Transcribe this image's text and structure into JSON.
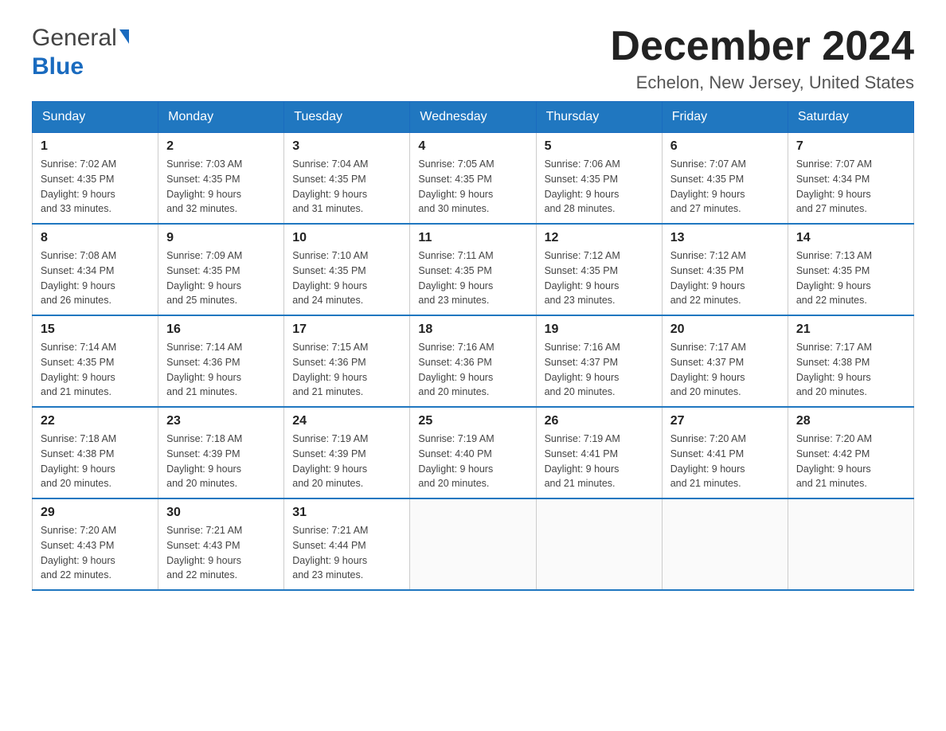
{
  "header": {
    "logo_general": "General",
    "logo_blue": "Blue",
    "title": "December 2024",
    "subtitle": "Echelon, New Jersey, United States"
  },
  "calendar": {
    "days_of_week": [
      "Sunday",
      "Monday",
      "Tuesday",
      "Wednesday",
      "Thursday",
      "Friday",
      "Saturday"
    ],
    "weeks": [
      [
        {
          "day": "1",
          "sunrise": "7:02 AM",
          "sunset": "4:35 PM",
          "daylight": "9 hours and 33 minutes."
        },
        {
          "day": "2",
          "sunrise": "7:03 AM",
          "sunset": "4:35 PM",
          "daylight": "9 hours and 32 minutes."
        },
        {
          "day": "3",
          "sunrise": "7:04 AM",
          "sunset": "4:35 PM",
          "daylight": "9 hours and 31 minutes."
        },
        {
          "day": "4",
          "sunrise": "7:05 AM",
          "sunset": "4:35 PM",
          "daylight": "9 hours and 30 minutes."
        },
        {
          "day": "5",
          "sunrise": "7:06 AM",
          "sunset": "4:35 PM",
          "daylight": "9 hours and 28 minutes."
        },
        {
          "day": "6",
          "sunrise": "7:07 AM",
          "sunset": "4:35 PM",
          "daylight": "9 hours and 27 minutes."
        },
        {
          "day": "7",
          "sunrise": "7:07 AM",
          "sunset": "4:34 PM",
          "daylight": "9 hours and 27 minutes."
        }
      ],
      [
        {
          "day": "8",
          "sunrise": "7:08 AM",
          "sunset": "4:34 PM",
          "daylight": "9 hours and 26 minutes."
        },
        {
          "day": "9",
          "sunrise": "7:09 AM",
          "sunset": "4:35 PM",
          "daylight": "9 hours and 25 minutes."
        },
        {
          "day": "10",
          "sunrise": "7:10 AM",
          "sunset": "4:35 PM",
          "daylight": "9 hours and 24 minutes."
        },
        {
          "day": "11",
          "sunrise": "7:11 AM",
          "sunset": "4:35 PM",
          "daylight": "9 hours and 23 minutes."
        },
        {
          "day": "12",
          "sunrise": "7:12 AM",
          "sunset": "4:35 PM",
          "daylight": "9 hours and 23 minutes."
        },
        {
          "day": "13",
          "sunrise": "7:12 AM",
          "sunset": "4:35 PM",
          "daylight": "9 hours and 22 minutes."
        },
        {
          "day": "14",
          "sunrise": "7:13 AM",
          "sunset": "4:35 PM",
          "daylight": "9 hours and 22 minutes."
        }
      ],
      [
        {
          "day": "15",
          "sunrise": "7:14 AM",
          "sunset": "4:35 PM",
          "daylight": "9 hours and 21 minutes."
        },
        {
          "day": "16",
          "sunrise": "7:14 AM",
          "sunset": "4:36 PM",
          "daylight": "9 hours and 21 minutes."
        },
        {
          "day": "17",
          "sunrise": "7:15 AM",
          "sunset": "4:36 PM",
          "daylight": "9 hours and 21 minutes."
        },
        {
          "day": "18",
          "sunrise": "7:16 AM",
          "sunset": "4:36 PM",
          "daylight": "9 hours and 20 minutes."
        },
        {
          "day": "19",
          "sunrise": "7:16 AM",
          "sunset": "4:37 PM",
          "daylight": "9 hours and 20 minutes."
        },
        {
          "day": "20",
          "sunrise": "7:17 AM",
          "sunset": "4:37 PM",
          "daylight": "9 hours and 20 minutes."
        },
        {
          "day": "21",
          "sunrise": "7:17 AM",
          "sunset": "4:38 PM",
          "daylight": "9 hours and 20 minutes."
        }
      ],
      [
        {
          "day": "22",
          "sunrise": "7:18 AM",
          "sunset": "4:38 PM",
          "daylight": "9 hours and 20 minutes."
        },
        {
          "day": "23",
          "sunrise": "7:18 AM",
          "sunset": "4:39 PM",
          "daylight": "9 hours and 20 minutes."
        },
        {
          "day": "24",
          "sunrise": "7:19 AM",
          "sunset": "4:39 PM",
          "daylight": "9 hours and 20 minutes."
        },
        {
          "day": "25",
          "sunrise": "7:19 AM",
          "sunset": "4:40 PM",
          "daylight": "9 hours and 20 minutes."
        },
        {
          "day": "26",
          "sunrise": "7:19 AM",
          "sunset": "4:41 PM",
          "daylight": "9 hours and 21 minutes."
        },
        {
          "day": "27",
          "sunrise": "7:20 AM",
          "sunset": "4:41 PM",
          "daylight": "9 hours and 21 minutes."
        },
        {
          "day": "28",
          "sunrise": "7:20 AM",
          "sunset": "4:42 PM",
          "daylight": "9 hours and 21 minutes."
        }
      ],
      [
        {
          "day": "29",
          "sunrise": "7:20 AM",
          "sunset": "4:43 PM",
          "daylight": "9 hours and 22 minutes."
        },
        {
          "day": "30",
          "sunrise": "7:21 AM",
          "sunset": "4:43 PM",
          "daylight": "9 hours and 22 minutes."
        },
        {
          "day": "31",
          "sunrise": "7:21 AM",
          "sunset": "4:44 PM",
          "daylight": "9 hours and 23 minutes."
        },
        null,
        null,
        null,
        null
      ]
    ],
    "labels": {
      "sunrise_prefix": "Sunrise: ",
      "sunset_prefix": "Sunset: ",
      "daylight_prefix": "Daylight: "
    }
  }
}
